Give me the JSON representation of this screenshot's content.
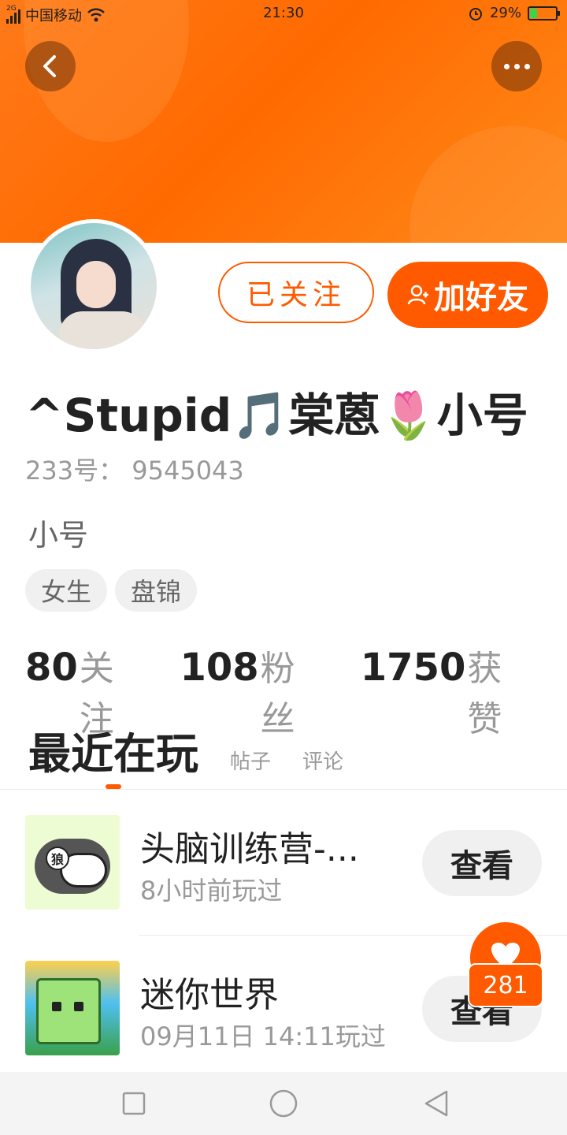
{
  "status_bar": {
    "network": "2G",
    "carrier": "中国移动",
    "time": "21:30",
    "battery": "29%",
    "icons": [
      "signal-icon",
      "wifi-icon",
      "alarm-icon",
      "battery-icon"
    ]
  },
  "header": {
    "back_icon": "chevron-left-icon",
    "more_icon": "more-dots-icon",
    "accent_color": "#ff5a00"
  },
  "profile": {
    "name": "^Stupid🎵棠蒽🌷小号",
    "uid": "233号： 9545043",
    "bio": "小号",
    "tags": [
      "女生",
      "盘锦"
    ],
    "followed_label": "已关注",
    "add_friend_label": "加好友",
    "stats": [
      {
        "value": "80",
        "label": "关注"
      },
      {
        "value": "108",
        "label": "粉丝"
      },
      {
        "value": "1750",
        "label": "获赞"
      }
    ]
  },
  "tabs": {
    "active": "最近在玩",
    "items": [
      "帖子",
      "评论"
    ]
  },
  "games": [
    {
      "title": "头脑训练营-...",
      "subtitle": "8小时前玩过",
      "button": "查看",
      "thumb_badge": "狼"
    },
    {
      "title": "迷你世界",
      "subtitle": "09月11日 14:11玩过",
      "button": "查看"
    }
  ],
  "like_bubble": {
    "icon": "heart-icon",
    "count": "281"
  },
  "nav": {
    "icons": [
      "square-icon",
      "circle-icon",
      "triangle-back-icon"
    ]
  }
}
